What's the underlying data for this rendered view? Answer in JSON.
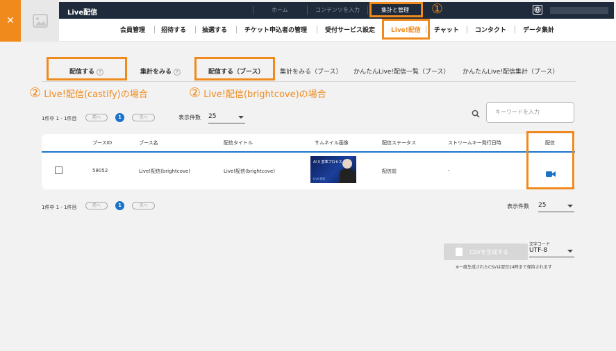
{
  "app": {
    "title": "Live配信"
  },
  "top_nav": [
    "ホーム",
    "コンテンツを入力",
    "集計と管理"
  ],
  "main_nav": [
    "会員管理",
    "招待する",
    "抽選する",
    "チケット申込者の管理",
    "受付サービス設定",
    "Live!配信",
    "チャット",
    "コンタクト",
    "データ集計"
  ],
  "annotations": {
    "step1": "①",
    "step2a": "②",
    "step2b": "②",
    "caption_castify": "Live!配信(castify)の場合",
    "caption_brightcove": "Live!配信(brightcove)の場合"
  },
  "tabs": [
    "配信する",
    "集計をみる",
    "配信する（ブース）",
    "集計をみる（ブース）",
    "かんたんLive!配信一覧（ブース）",
    "かんたんLive!配信集計（ブース）"
  ],
  "pager": {
    "summary": "1件中 1 - 1件目",
    "prev": "前へ",
    "current": "1",
    "next": "次へ",
    "per_page_label": "表示件数",
    "per_page_value": "25"
  },
  "search": {
    "placeholder": "キーワードを入力"
  },
  "table": {
    "columns": [
      "ブースID",
      "ブース名",
      "配信タイトル",
      "サムネイル画像",
      "配信ステータス",
      "ストリームキー発行日時",
      "配信"
    ],
    "rows": [
      {
        "booth_id": "58052",
        "booth_name": "Live!配信(brightcove)",
        "title": "Live!配信(brightcove)",
        "thumb_text": "AI X 変革プロセス 手法",
        "thumb_sub": "Live 配信",
        "status": "配信前",
        "issued_at": "-"
      }
    ]
  },
  "csv": {
    "button": "CSVを生成する",
    "encoding_label": "文字コード",
    "encoding_value": "UTF-8",
    "note": "※一度生成されたCSVは翌日24時まで保持されます"
  },
  "colors": {
    "accent": "#f08a1c",
    "primary": "#1a73c9",
    "topbar": "#1f2b3a"
  },
  "icons": [
    "close-icon",
    "image-placeholder-icon",
    "globe-icon",
    "help-icon",
    "search-icon",
    "video-camera-icon",
    "document-icon",
    "chevron-down-icon"
  ]
}
